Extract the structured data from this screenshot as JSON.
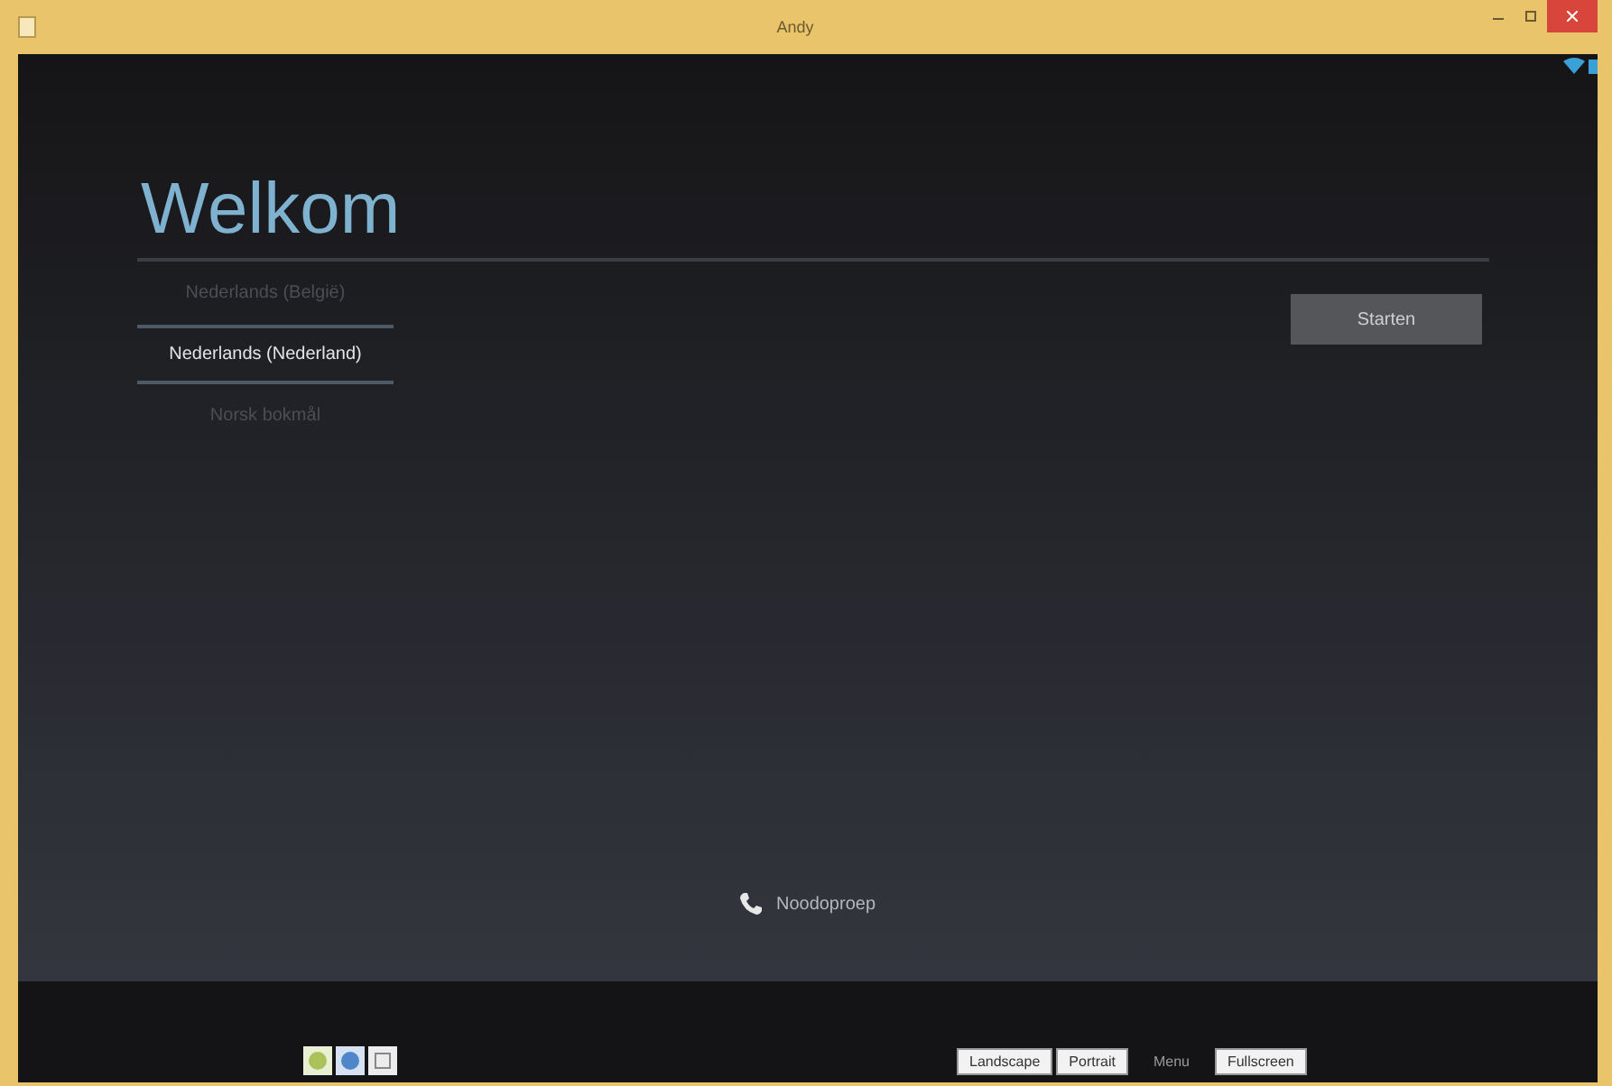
{
  "window": {
    "title": "Andy"
  },
  "setup": {
    "heading": "Welkom",
    "languages": [
      {
        "label": "Nederlands (België)",
        "selected": false
      },
      {
        "label": "Nederlands (Nederland)",
        "selected": true
      },
      {
        "label": "Norsk bokmål",
        "selected": false
      }
    ],
    "start_button": "Starten",
    "emergency_call": "Noodoproep"
  },
  "toolbar": {
    "buttons": [
      {
        "label": "Landscape"
      },
      {
        "label": "Portrait"
      }
    ],
    "status": "Menu",
    "fullscreen": "Fullscreen"
  }
}
